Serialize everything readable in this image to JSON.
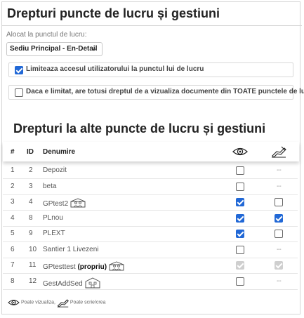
{
  "section1": {
    "title": "Drepturi puncte de lucru și gestiuni",
    "assigned_label": "Alocat la punctul de lucru:",
    "assigned_value": "Sediu Principal - En-Detail",
    "option_limit": {
      "label": "Limiteaza accesul utilizatorului la punctul lui de lucru",
      "checked": true
    },
    "option_view_all": {
      "label": "Daca e limitat, are totusi dreptul de a vizualiza documente din TOATE punctele de lucru",
      "checked": false
    }
  },
  "section2": {
    "title": "Drepturi la alte puncte de lucru și gestiuni",
    "columns": {
      "nr": "#",
      "id": "ID",
      "name": "Denumire"
    },
    "rows": [
      {
        "nr": "1",
        "id": "2",
        "name": "Depozit",
        "bold_suffix": "",
        "icon": "",
        "view": "off",
        "write": "--"
      },
      {
        "nr": "2",
        "id": "3",
        "name": "beta",
        "bold_suffix": "",
        "icon": "",
        "view": "off",
        "write": "--"
      },
      {
        "nr": "3",
        "id": "4",
        "name": "GPtest2",
        "bold_suffix": "",
        "icon": "warehouse-people-icon",
        "view": "on",
        "write": "off"
      },
      {
        "nr": "4",
        "id": "8",
        "name": "PLnou",
        "bold_suffix": "",
        "icon": "",
        "view": "on",
        "write": "on"
      },
      {
        "nr": "5",
        "id": "9",
        "name": "PLEXT",
        "bold_suffix": "",
        "icon": "",
        "view": "on",
        "write": "off"
      },
      {
        "nr": "6",
        "id": "10",
        "name": "Santier 1 Livezeni",
        "bold_suffix": "",
        "icon": "",
        "view": "off",
        "write": "--"
      },
      {
        "nr": "7",
        "id": "11",
        "name": "GPtesttest",
        "bold_suffix": "(propriu)",
        "icon": "warehouse-people-icon",
        "view": "disabled",
        "write": "disabled"
      },
      {
        "nr": "8",
        "id": "12",
        "name": "GestAddSed",
        "bold_suffix": "",
        "icon": "warehouse-building-icon",
        "view": "off",
        "write": "--"
      }
    ]
  },
  "legend": {
    "view_text": "Poate vizualiza,",
    "write_text": "Poate scrie/crea"
  },
  "colors": {
    "accent": "#2168d6",
    "disabled": "#cfcfcf"
  }
}
